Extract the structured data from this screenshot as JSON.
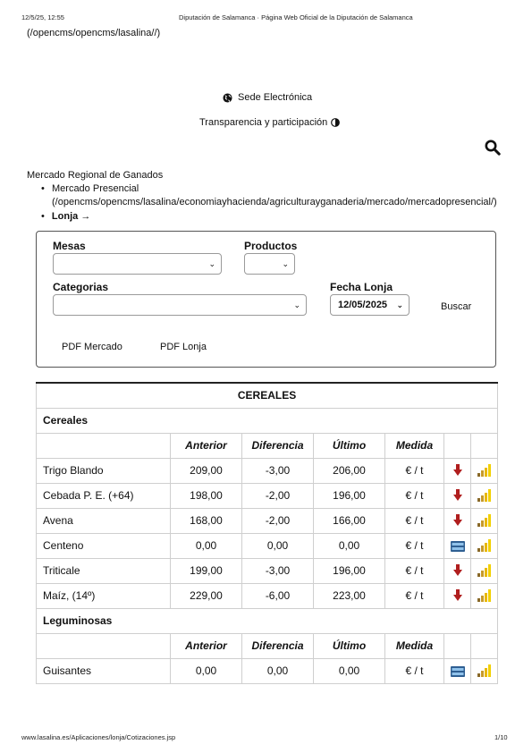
{
  "print_header": {
    "date": "12/5/25, 12:55",
    "title": "Diputación de Salamanca · Página Web Oficial de la Diputación de Salamanca"
  },
  "print_footer": {
    "url": "www.lasalina.es/Aplicaciones/lonja/Cotizaciones.jsp",
    "page": "1/10"
  },
  "site": {
    "home_link": "(/opencms/opencms/lasalina//)",
    "sede_label": "Sede Electrónica",
    "transparencia_label": "Transparencia y participación"
  },
  "breadcrumb": {
    "root": "Mercado Regional de Ganados",
    "item1_label": "Mercado Presencial",
    "item1_url": "(/opencms/opencms/lasalina/economiayhacienda/agriculturayganaderia/mercado/mercadopresencial/)",
    "item2_label": "Lonja",
    "item2_arrow": "→"
  },
  "form": {
    "mesas_label": "Mesas",
    "mesas_value": "",
    "productos_label": "Productos",
    "productos_value": "",
    "categorias_label": "Categorias",
    "categorias_value": "",
    "fecha_label": "Fecha Lonja",
    "fecha_value": "12/05/2025",
    "buscar_label": "Buscar",
    "pdf_mercado_label": "PDF Mercado",
    "pdf_lonja_label": "PDF Lonja"
  },
  "table": {
    "title": "CEREALES",
    "headers": [
      "Anterior",
      "Diferencia",
      "Último",
      "Medida"
    ],
    "sections": [
      {
        "name": "Cereales",
        "rows": [
          {
            "product": "Trigo Blando",
            "anterior": "209,00",
            "diferencia": "-3,00",
            "ultimo": "206,00",
            "medida": "€ / t",
            "trend": "down"
          },
          {
            "product": "Cebada P. E. (+64)",
            "anterior": "198,00",
            "diferencia": "-2,00",
            "ultimo": "196,00",
            "medida": "€ / t",
            "trend": "down"
          },
          {
            "product": "Avena",
            "anterior": "168,00",
            "diferencia": "-2,00",
            "ultimo": "166,00",
            "medida": "€ / t",
            "trend": "down"
          },
          {
            "product": "Centeno",
            "anterior": "0,00",
            "diferencia": "0,00",
            "ultimo": "0,00",
            "medida": "€ / t",
            "trend": "equal"
          },
          {
            "product": "Triticale",
            "anterior": "199,00",
            "diferencia": "-3,00",
            "ultimo": "196,00",
            "medida": "€ / t",
            "trend": "down"
          },
          {
            "product": "Maíz, (14º)",
            "anterior": "229,00",
            "diferencia": "-6,00",
            "ultimo": "223,00",
            "medida": "€ / t",
            "trend": "down"
          }
        ]
      },
      {
        "name": "Leguminosas",
        "rows": [
          {
            "product": "Guisantes",
            "anterior": "0,00",
            "diferencia": "0,00",
            "ultimo": "0,00",
            "medida": "€ / t",
            "trend": "equal"
          }
        ]
      }
    ]
  },
  "icons": {
    "trend_down": "arrow-down-icon",
    "trend_equal": "equal-icon",
    "chart": "bar-chart-icon",
    "globe": "globe-icon",
    "contrast": "contrast-icon",
    "search": "search-icon"
  },
  "colors": {
    "down_arrow": "#b01e1e",
    "equal_icon": "#4a7fb5",
    "chart_bar": "#e8b800"
  }
}
